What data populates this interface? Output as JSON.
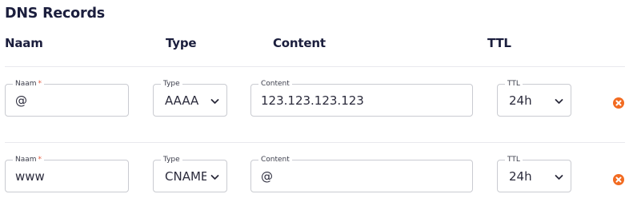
{
  "section_title": "DNS Records",
  "columns": {
    "name": "Naam",
    "type": "Type",
    "content": "Content",
    "ttl": "TTL"
  },
  "field_labels": {
    "name": "Naam",
    "required_mark": "*",
    "type": "Type",
    "content": "Content",
    "ttl": "TTL"
  },
  "records": [
    {
      "name": "@",
      "type": "AAAA",
      "content": "123.123.123.123",
      "ttl": "24h"
    },
    {
      "name": "www",
      "type": "CNAME",
      "content": "@",
      "ttl": "24h"
    }
  ],
  "icons": {
    "delete": "remove-circle-icon",
    "select": "chevron-down-icon"
  },
  "colors": {
    "accent_delete": "#f26b21",
    "required": "#e45a3e",
    "heading": "#1b1e3d",
    "border": "#c9cbd1"
  }
}
